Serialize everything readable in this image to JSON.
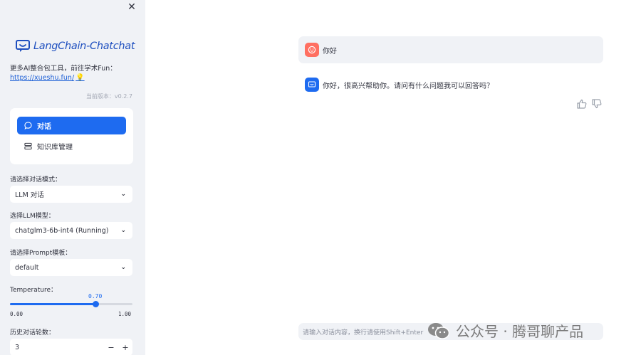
{
  "sidebar": {
    "logo_text": "LangChain-Chatchat",
    "promo_text": "更多AI整合包工具，前往学术Fun：",
    "promo_link": "https://xueshu.fun/",
    "version": "当前版本：v0.2.7",
    "nav": [
      {
        "label": "对话",
        "icon": "chat-bubble-icon",
        "active": true
      },
      {
        "label": "知识库管理",
        "icon": "database-icon",
        "active": false
      }
    ],
    "mode_label": "请选择对话模式：",
    "mode_value": "LLM 对话",
    "model_label": "选择LLM模型：",
    "model_value": "chatglm3-6b-int4 (Running)",
    "prompt_label": "请选择Prompt模板：",
    "prompt_value": "default",
    "temperature_label": "Temperature：",
    "temperature_value": "0.70",
    "temperature_min": "0.00",
    "temperature_max": "1.00",
    "temperature_fraction": 0.7,
    "history_label": "历史对话轮数：",
    "history_value": "3",
    "stepper_minus": "−",
    "stepper_plus": "+"
  },
  "chat": {
    "messages": [
      {
        "role": "user",
        "text": "你好"
      },
      {
        "role": "assistant",
        "text": "你好，很高兴帮助你。请问有什么问题我可以回答吗？"
      }
    ],
    "input_placeholder": "请输入对话内容，换行请使用Shift+Enter"
  },
  "watermark": "公众号 · 腾哥聊产品",
  "colors": {
    "accent": "#1e6bf0",
    "user_avatar": "#ff6f61",
    "sidebar_bg": "#f0f2f6",
    "logo": "#1e4fbf"
  }
}
